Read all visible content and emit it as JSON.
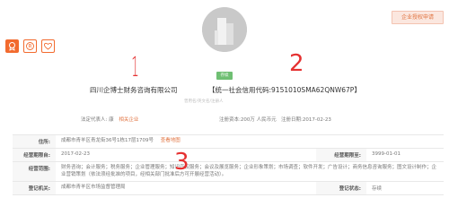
{
  "header": {
    "claim_button": "企业授权申请"
  },
  "profile": {
    "status": "存续",
    "company_name": "四川企博士财务咨询有限公司",
    "credit_code": "【统一社会信用代码:9151010SMA62QNW67P】",
    "former_name": "曾用名/英文名/注册人 ",
    "legal_rep_label": "法定代表人:",
    "legal_rep_name": "康",
    "related_link": "相关企业",
    "registered_capital": "注册资本:200万 人民币元",
    "established_date": "注册日期:2017-02-23"
  },
  "details": {
    "rows": [
      {
        "label": "住所:",
        "value": "成都市青羊区青龙街36号1栋17层1709号",
        "link": "查看地图"
      },
      {
        "label": "经营期限自:",
        "value": "2017-02-23",
        "label2": "经营期限至:",
        "value2": "3999-01-01"
      },
      {
        "label": "经营范围:",
        "value": "财务咨询；会计服务；税务服务；企业管理服务；知识产权服务；会议及展览服务；企业形象策划；市场调查；软件开发；广告设计；商务信息咨询服务；图文设计制作；企业营销策划（依法须经批准的项目，经相关部门批准后方可开展经营活动）。"
      },
      {
        "label": "登记机关:",
        "value": "成都市青羊区市场监督管理局",
        "label2": "登记状态:",
        "value2": "存续"
      }
    ]
  },
  "annotations": {
    "one": "1",
    "two": "2",
    "three": "3"
  },
  "colors": {
    "accent": "#e0723f",
    "badge": "#f26a2e",
    "status": "#6fbf73",
    "annotation": "#e53030"
  },
  "icons": [
    "building-logo-icon",
    "certificate-icon",
    "trademark-icon",
    "heart-icon"
  ]
}
